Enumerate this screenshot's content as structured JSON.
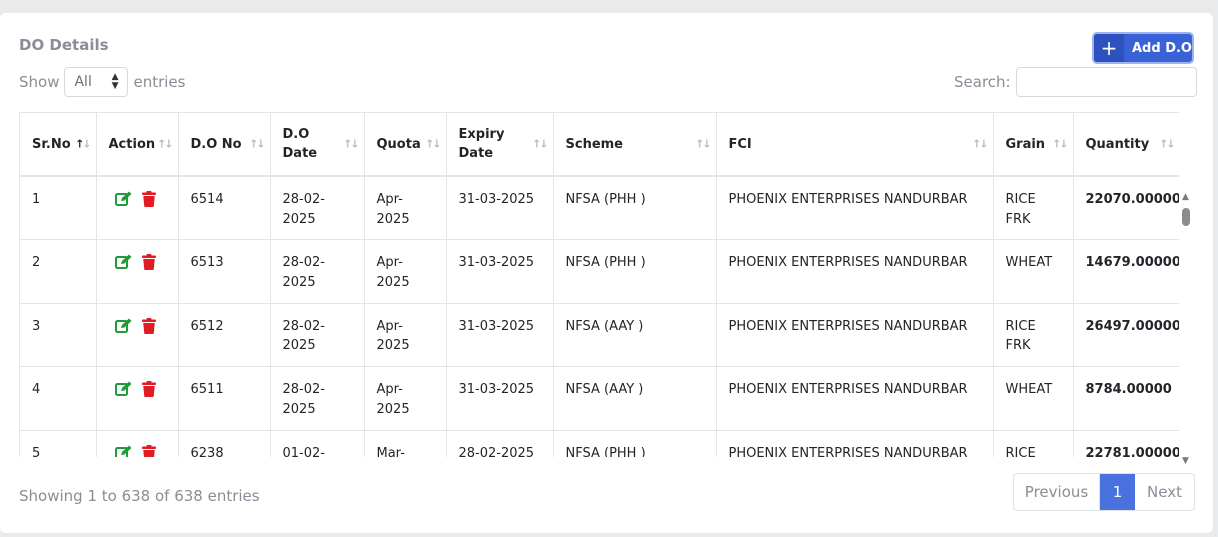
{
  "card": {
    "title": "DO Details"
  },
  "add_button": {
    "label": "Add D.O",
    "icon": "plus-icon"
  },
  "length_control": {
    "show": "Show",
    "selected": "All",
    "entries": "entries"
  },
  "search": {
    "label": "Search:",
    "value": ""
  },
  "table": {
    "columns": [
      {
        "label": "Sr.No",
        "line2": ""
      },
      {
        "label": "Action",
        "line2": ""
      },
      {
        "label": "D.O No",
        "line2": ""
      },
      {
        "label": "D.O",
        "line2": "Date"
      },
      {
        "label": "Quota",
        "line2": ""
      },
      {
        "label": "Expiry",
        "line2": "Date"
      },
      {
        "label": "Scheme",
        "line2": ""
      },
      {
        "label": "FCI",
        "line2": ""
      },
      {
        "label": "Grain",
        "line2": ""
      },
      {
        "label": "Quantity",
        "line2": ""
      }
    ],
    "rows": [
      {
        "sr": "1",
        "do_no": "6514",
        "do_date": "28-02-",
        "do_date2": "2025",
        "quota": "Apr-",
        "quota2": "2025",
        "expiry": "31-03-2025",
        "scheme": "NFSA (PHH )",
        "fci": "PHOENIX ENTERPRISES NANDURBAR",
        "grain": "RICE FRK",
        "quantity": "22070.00000"
      },
      {
        "sr": "2",
        "do_no": "6513",
        "do_date": "28-02-",
        "do_date2": "2025",
        "quota": "Apr-",
        "quota2": "2025",
        "expiry": "31-03-2025",
        "scheme": "NFSA (PHH )",
        "fci": "PHOENIX ENTERPRISES NANDURBAR",
        "grain": "WHEAT",
        "quantity": "14679.00000"
      },
      {
        "sr": "3",
        "do_no": "6512",
        "do_date": "28-02-",
        "do_date2": "2025",
        "quota": "Apr-",
        "quota2": "2025",
        "expiry": "31-03-2025",
        "scheme": "NFSA (AAY )",
        "fci": "PHOENIX ENTERPRISES NANDURBAR",
        "grain": "RICE FRK",
        "quantity": "26497.00000"
      },
      {
        "sr": "4",
        "do_no": "6511",
        "do_date": "28-02-",
        "do_date2": "2025",
        "quota": "Apr-",
        "quota2": "2025",
        "expiry": "31-03-2025",
        "scheme": "NFSA (AAY )",
        "fci": "PHOENIX ENTERPRISES NANDURBAR",
        "grain": "WHEAT",
        "quantity": "8784.00000"
      },
      {
        "sr": "5",
        "do_no": "6238",
        "do_date": "01-02-",
        "do_date2": "",
        "quota": "Mar-",
        "quota2": "",
        "expiry": "28-02-2025",
        "scheme": "NFSA (PHH )",
        "fci": "PHOENIX ENTERPRISES NANDURBAR",
        "grain": "RICE FRK",
        "quantity": "22781.00000"
      }
    ]
  },
  "footer": {
    "info": "Showing 1 to 638 of 638 entries"
  },
  "pagination": {
    "previous": "Previous",
    "page": "1",
    "next": "Next"
  },
  "colors": {
    "primary": "#3a62d7",
    "edit": "#1e9b3a",
    "delete": "#e01b24",
    "muted": "#8a8d96"
  }
}
